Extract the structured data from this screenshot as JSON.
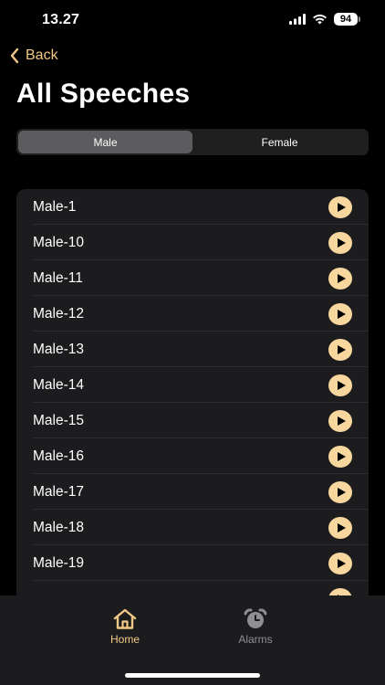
{
  "status": {
    "time": "13.27",
    "battery": "94"
  },
  "nav": {
    "back_label": "Back",
    "title": "All Speeches"
  },
  "segments": {
    "male": "Male",
    "female": "Female",
    "selected": "Male"
  },
  "speeches": [
    "Male-1",
    "Male-10",
    "Male-11",
    "Male-12",
    "Male-13",
    "Male-14",
    "Male-15",
    "Male-16",
    "Male-17",
    "Male-18",
    "Male-19"
  ],
  "tabs": {
    "home": "Home",
    "alarms": "Alarms",
    "active": "Home"
  },
  "colors": {
    "accent": "#f3c887",
    "play_button": "#f7d79e",
    "background": "#000000",
    "surface": "#1c1c1e"
  }
}
